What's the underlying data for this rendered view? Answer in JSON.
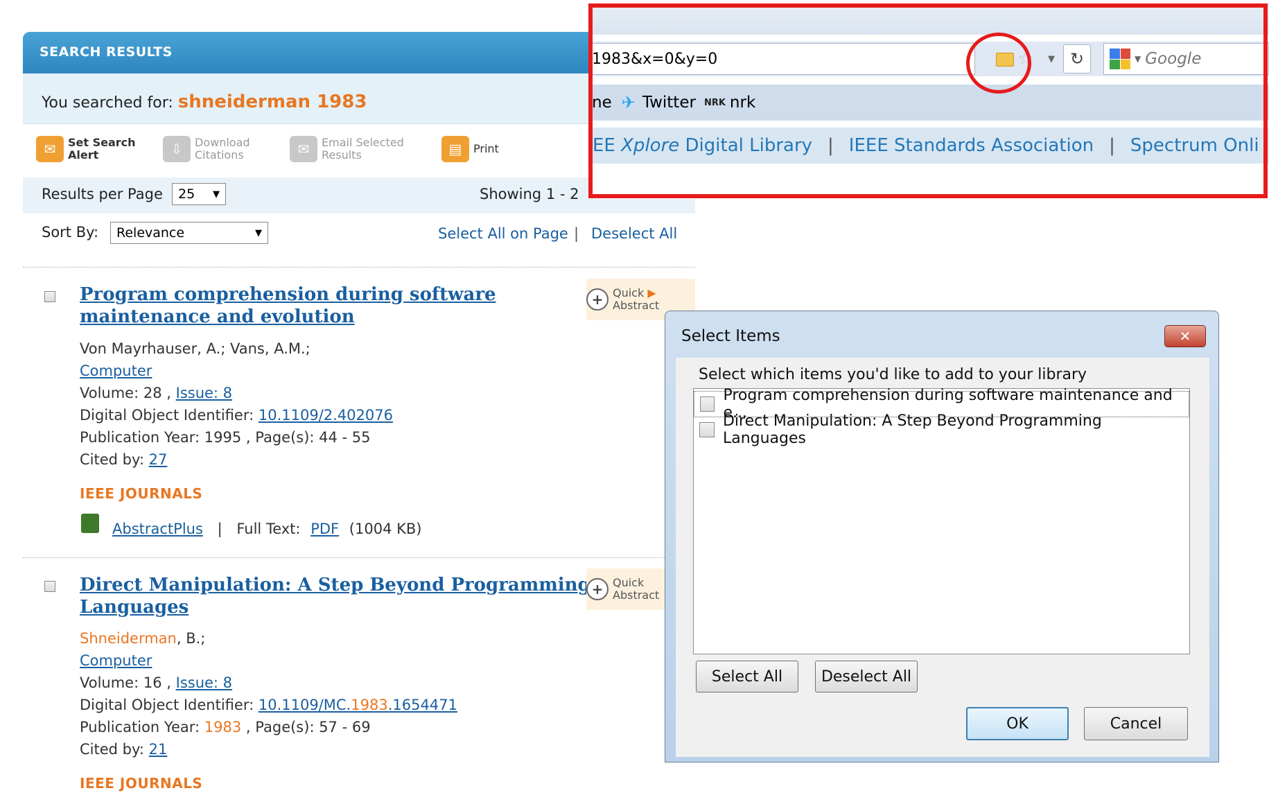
{
  "search": {
    "header": "SEARCH RESULTS",
    "you_searched_label": "You searched for:",
    "query": "shneiderman 1983",
    "toolbar": {
      "set_alert_line1": "Set Search",
      "set_alert_line2": "Alert",
      "download_line1": "Download",
      "download_line2": "Citations",
      "email_line1": "Email Selected",
      "email_line2": "Results",
      "print": "Print"
    },
    "results_per_page_label": "Results per Page",
    "results_per_page_value": "25",
    "showing": "Showing 1 - 2",
    "sort_label": "Sort By:",
    "sort_value": "Relevance",
    "select_all_on_page": "Select All on Page",
    "separator": "|",
    "deselect_all": "Deselect All",
    "quick_abstract_line1": "Quick",
    "quick_abstract_line2": "Abstract",
    "results": [
      {
        "title_line1": "Program comprehension during software",
        "title_line2": "maintenance and evolution",
        "authors": "Von Mayrhauser, A.; Vans, A.M.;",
        "journal": "Computer",
        "volume_label": "Volume: 28 ,",
        "issue": "Issue: 8",
        "doi_label": "Digital Object Identifier:",
        "doi": "10.1109/2.402076",
        "pub_year": "Publication Year: 1995 , Page(s): 44 - 55",
        "cited_label": "Cited by:",
        "cited": "27",
        "category": "IEEE JOURNALS",
        "abstractplus": "AbstractPlus",
        "full_text_label": "Full Text:",
        "pdf": "PDF",
        "size": "(1004 KB)"
      },
      {
        "title_line1": "Direct Manipulation: A Step Beyond Programming",
        "title_line2": "Languages",
        "author_highlight": "Shneiderman",
        "author_rest": ", B.;",
        "journal": "Computer",
        "volume_label": "Volume: 16 ,",
        "issue": "Issue: 8",
        "doi_label": "Digital Object Identifier:",
        "doi_a": "10.1109/MC.",
        "doi_b": "1983",
        "doi_c": ".1654471",
        "pub_year_a": "Publication Year:",
        "pub_year_b": "1983",
        "pub_year_c": ", Page(s): 57 - 69",
        "cited_label": "Cited by:",
        "cited": "21",
        "category": "IEEE JOURNALS"
      }
    ]
  },
  "browser": {
    "url_fragment": "1983&x=0&y=0",
    "search_engine": "Google",
    "bookmarks": {
      "partial": "ne",
      "twitter": "Twitter",
      "nrk_logo": "NRK",
      "nrk": "nrk"
    },
    "ieee_links": {
      "xplore_a": "EE",
      "xplore_b": "Xplore",
      "xplore_c": "Digital Library",
      "sep": "|",
      "standards": "IEEE Standards Association",
      "spectrum": "Spectrum Onli"
    }
  },
  "dialog": {
    "title": "Select Items",
    "close": "✕",
    "prompt": "Select which items you'd like to add to your library",
    "items": [
      "Program comprehension during software maintenance and e...",
      "Direct Manipulation: A Step Beyond Programming Languages"
    ],
    "select_all": "Select All",
    "deselect_all": "Deselect All",
    "ok": "OK",
    "cancel": "Cancel"
  },
  "colors": {
    "header_blue": "#3a95cc",
    "accent_orange": "#e87722",
    "link_blue": "#1a5fa0",
    "annotation_red": "#e61b1b"
  }
}
